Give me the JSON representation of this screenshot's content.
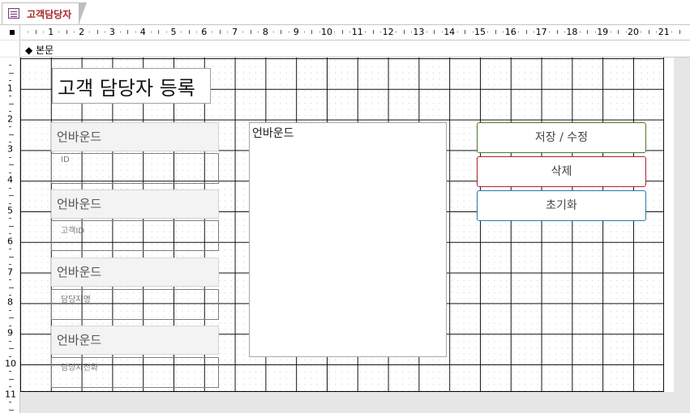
{
  "tab": {
    "title": "고객담당자"
  },
  "section": {
    "label": "본문"
  },
  "ruler": {
    "top_numbers": [
      "1",
      "2",
      "3",
      "4",
      "5",
      "6",
      "7",
      "8",
      "9",
      "10",
      "11",
      "12",
      "13",
      "14",
      "15",
      "16",
      "17",
      "18",
      "19",
      "20",
      "21"
    ],
    "left_numbers": [
      "1",
      "2",
      "3",
      "4",
      "5",
      "6",
      "7",
      "8",
      "9",
      "10",
      "11"
    ]
  },
  "form": {
    "title": "고객 담당자 등록",
    "fields": [
      {
        "unbound_label": "언바운드",
        "caption": "ID"
      },
      {
        "unbound_label": "언바운드",
        "caption": "고객ID"
      },
      {
        "unbound_label": "언바운드",
        "caption": "담당자명"
      },
      {
        "unbound_label": "언바운드",
        "caption": "담당자전화"
      }
    ],
    "listbox_label": "언바운드",
    "buttons": {
      "save": "저장 / 수정",
      "delete": "삭제",
      "reset": "초기화"
    }
  },
  "colors": {
    "tab_text": "#a52a2a",
    "save_border": "#4c7a2a",
    "delete_border": "#b02030",
    "reset_border": "#2a7aa8"
  }
}
